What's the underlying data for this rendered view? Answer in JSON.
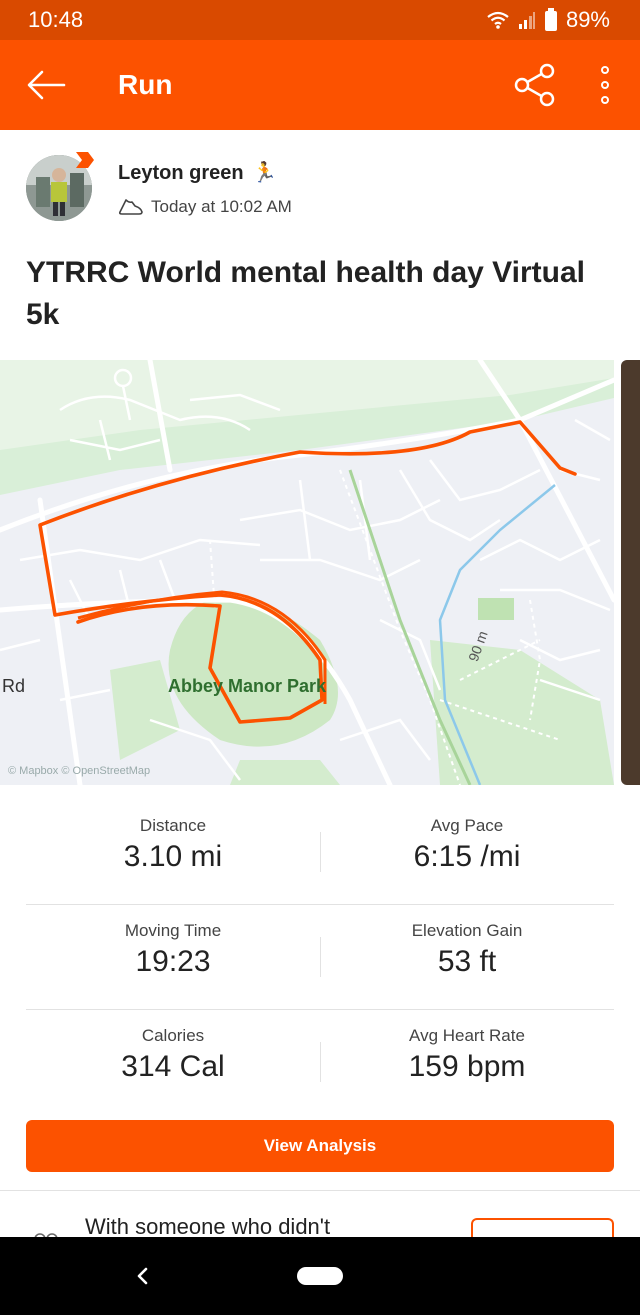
{
  "status_bar": {
    "time": "10:48",
    "battery": "89%",
    "icons": [
      "wifi-icon",
      "signal-icon",
      "battery-icon"
    ]
  },
  "app_bar": {
    "title": "Run",
    "icons": [
      "back-arrow-icon",
      "share-icon",
      "more-vert-icon"
    ],
    "background": "#fc5200"
  },
  "athlete": {
    "name": "Leyton green",
    "emoji": "🏃",
    "time_label": "Today at 10:02 AM",
    "time_icon": "shoe-icon"
  },
  "activity": {
    "title": "YTRRC World mental health day Virtual 5k"
  },
  "map": {
    "labels": {
      "park": "Abbey Manor Park",
      "road": "Rd",
      "contour": "90 m",
      "attribution": "© Mapbox © OpenStreetMap"
    },
    "route_color": "#fc5200"
  },
  "stats": [
    {
      "label": "Distance",
      "value": "3.10 mi"
    },
    {
      "label": "Avg Pace",
      "value": "6:15 /mi"
    },
    {
      "label": "Moving Time",
      "value": "19:23"
    },
    {
      "label": "Elevation Gain",
      "value": "53 ft"
    },
    {
      "label": "Calories",
      "value": "314 Cal"
    },
    {
      "label": "Avg Heart Rate",
      "value": "159 bpm"
    }
  ],
  "actions": {
    "analysis_label": "View Analysis"
  },
  "invite": {
    "text": "With someone who didn't"
  },
  "nav": {
    "icons": [
      "nav-back-icon",
      "nav-home-pill"
    ]
  },
  "colors": {
    "accent": "#fc5200",
    "status_bar": "#d94a00",
    "park_green": "#cde8c4"
  }
}
